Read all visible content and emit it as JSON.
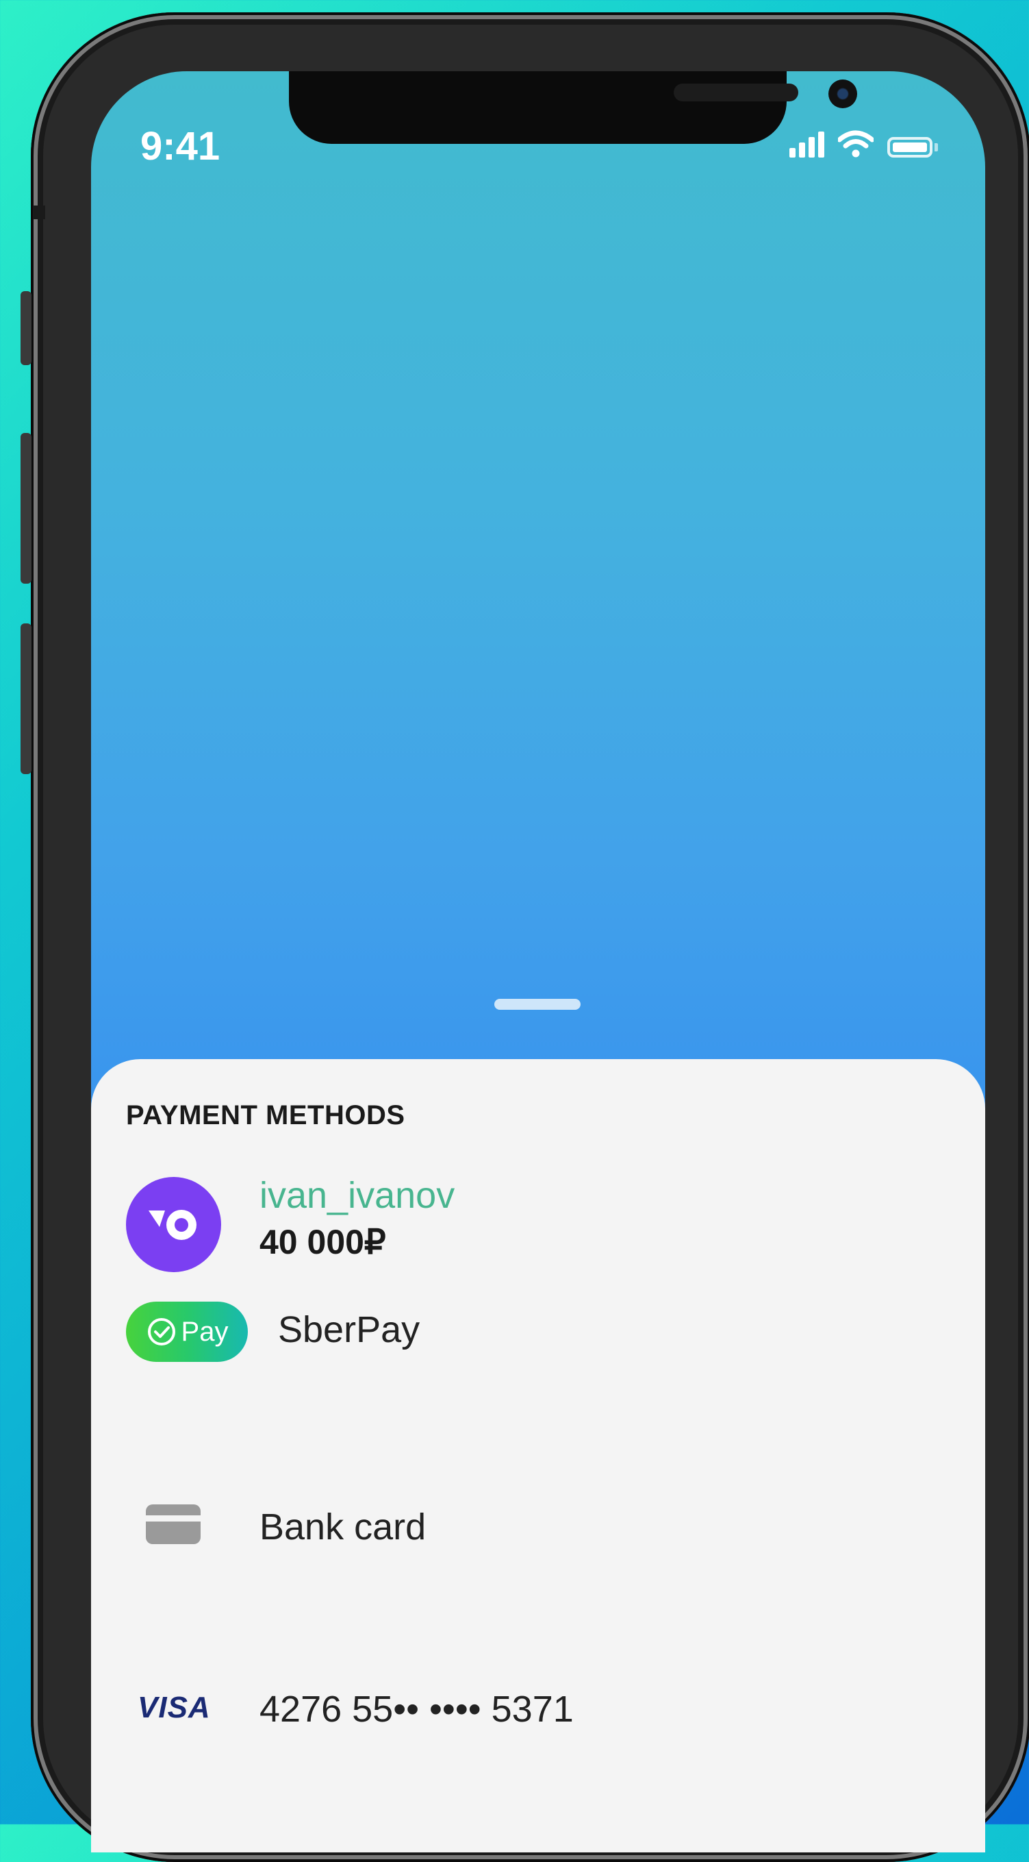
{
  "status_bar": {
    "time": "9:41",
    "icons": [
      "cellular-signal-icon",
      "wifi-icon",
      "battery-icon"
    ]
  },
  "payment_sheet": {
    "title": "PAYMENT METHODS",
    "methods": [
      {
        "icon": "yoomoney-logo-icon",
        "name": "ivan_ivanov",
        "balance": "40 000₽"
      },
      {
        "icon": "sberpay-logo-icon",
        "badge": "Pay",
        "label": "SberPay"
      },
      {
        "icon": "bank-card-icon",
        "label": "Bank card"
      },
      {
        "icon": "visa-logo-icon",
        "brand": "VISA",
        "label": "4276 55•• •••• 5371"
      }
    ]
  },
  "colors": {
    "accent_green": "#48b58f",
    "yoomoney_purple": "#7b3ff2",
    "visa_navy": "#1a2a74",
    "sheet_background": "#f4f4f4"
  }
}
